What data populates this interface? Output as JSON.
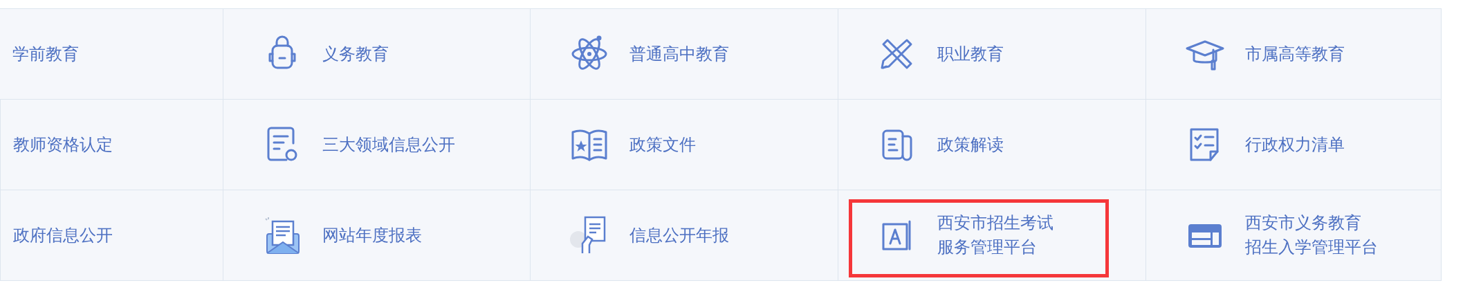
{
  "rows": [
    {
      "cells": [
        {
          "kind": "text",
          "label": "学前教育",
          "highlighted": false
        },
        {
          "kind": "icon-link",
          "label": "义务教育",
          "highlighted": false
        },
        {
          "kind": "icon-link",
          "label": "普通高中教育",
          "highlighted": false
        },
        {
          "kind": "icon-link",
          "label": "职业教育",
          "highlighted": false
        },
        {
          "kind": "icon-link",
          "label": "市属高等教育",
          "highlighted": false
        }
      ]
    },
    {
      "cells": [
        {
          "kind": "text",
          "label": "教师资格认定",
          "highlighted": false
        },
        {
          "kind": "icon-link",
          "label": "三大领域信息公开",
          "highlighted": false
        },
        {
          "kind": "icon-link",
          "label": "政策文件",
          "highlighted": false
        },
        {
          "kind": "icon-link",
          "label": "政策解读",
          "highlighted": false
        },
        {
          "kind": "icon-link",
          "label": "行政权力清单",
          "highlighted": false
        }
      ]
    },
    {
      "cells": [
        {
          "kind": "text",
          "label": "政府信息公开",
          "highlighted": false
        },
        {
          "kind": "icon-link",
          "label": "网站年度报表",
          "highlighted": false
        },
        {
          "kind": "icon-link",
          "label": "信息公开年报",
          "highlighted": false
        },
        {
          "kind": "icon-link",
          "lines": [
            "西安市招生考试",
            "服务管理平台"
          ],
          "highlighted": true
        },
        {
          "kind": "icon-link",
          "lines": [
            "西安市义务教育",
            "招生入学管理平台"
          ],
          "highlighted": false
        }
      ]
    }
  ]
}
